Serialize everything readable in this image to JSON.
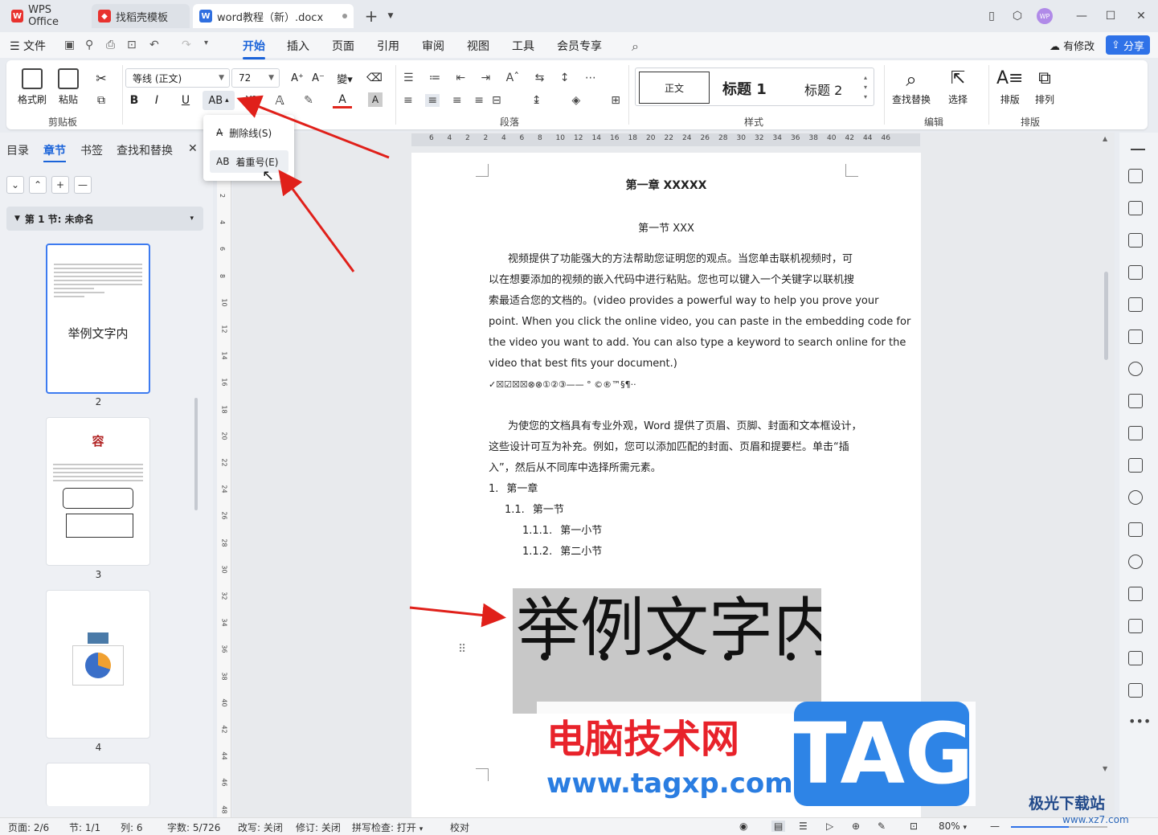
{
  "titlebar": {
    "tabs": [
      {
        "label": "WPS Office"
      },
      {
        "label": "找稻壳模板"
      },
      {
        "label": "word教程（新）.docx"
      }
    ],
    "new_tab": "+",
    "avatar": "WP"
  },
  "menubar": {
    "file": "文件",
    "items": [
      "开始",
      "插入",
      "页面",
      "引用",
      "审阅",
      "视图",
      "工具",
      "会员专享"
    ],
    "modified": "有修改",
    "share": "分享"
  },
  "ribbon": {
    "clipboard": {
      "format_painter": "格式刷",
      "paste": "粘贴",
      "group": "剪贴板"
    },
    "font": {
      "name": "等线 (正文)",
      "size": "72",
      "bold": "B",
      "italic": "I",
      "underline": "U",
      "emphasis_btn": "AB",
      "super": "X²",
      "font_color": "A",
      "highlight": "A"
    },
    "paragraph": {
      "group": "段落"
    },
    "styles": {
      "normal": "正文",
      "h1": "标题 1",
      "h2": "标题 2",
      "group": "样式"
    },
    "edit": {
      "find": "查找替换",
      "select": "选择",
      "group": "编辑"
    },
    "layout": {
      "arrange": "排版",
      "order": "排列",
      "group": "排版"
    }
  },
  "dropdown": {
    "items": [
      {
        "label": "删除线(S)"
      },
      {
        "label": "着重号(E)"
      }
    ]
  },
  "leftpanel": {
    "tabs": [
      "目录",
      "章节",
      "书签",
      "查找和替换"
    ],
    "section": "第 1 节: 未命名",
    "thumb2_text": "举例文字内",
    "thumb3_text": "容",
    "pages": [
      "2",
      "3",
      "4"
    ]
  },
  "ruler": {
    "h_ticks": [
      "6",
      "4",
      "2",
      "2",
      "4",
      "6",
      "8",
      "10",
      "12",
      "14",
      "16",
      "18",
      "20",
      "22",
      "24",
      "26",
      "28",
      "30",
      "32",
      "34",
      "36",
      "38",
      "40",
      "42",
      "44",
      "46"
    ],
    "v_ticks": [
      "2",
      "4",
      "6",
      "8",
      "10",
      "12",
      "14",
      "16",
      "18",
      "20",
      "22",
      "24",
      "26",
      "28",
      "30",
      "32",
      "34",
      "36",
      "38",
      "40",
      "42",
      "44",
      "46",
      "48"
    ]
  },
  "document": {
    "chapter": "第一章  XXXXX",
    "section": "第一节 XXX",
    "p1_lines": [
      "视频提供了功能强大的方法帮助您证明您的观点。当您单击联机视频时，可",
      "以在想要添加的视频的嵌入代码中进行粘贴。您也可以键入一个关键字以联机搜",
      "索最适合您的文档的。(video provides a powerful way to help you prove your",
      "point. When you click the online video, you can paste in the embedding code for",
      "the video you want to add. You can also type a keyword to search online for the",
      "video that best fits your document.)"
    ],
    "symbols": "✓☒☑☒☒⊗⊗①②③——    °  ©®™§¶··",
    "p2_lines": [
      "为使您的文档具有专业外观，Word  提供了页眉、页脚、封面和文本框设计，",
      "这些设计可互为补充。例如，您可以添加匹配的封面、页眉和提要栏。单击“插",
      "入”，然后从不同库中选择所需元素。"
    ],
    "list": [
      {
        "num": "1.",
        "text": "第一章"
      },
      {
        "num": "1.1.",
        "text": "第一节"
      },
      {
        "num": "1.1.1.",
        "text": "第一小节"
      },
      {
        "num": "1.1.2.",
        "text": "第二小节"
      }
    ],
    "big_text": "举例文字内"
  },
  "watermark": {
    "title": "电脑技术网",
    "url": "www.tagxp.com",
    "tag": "TAG",
    "site2": "极光下载站",
    "site2_url": "www.xz7.com"
  },
  "statusbar": {
    "page": "页面: 2/6",
    "section": "节: 1/1",
    "col": "列: 6",
    "words": "字数: 5/726",
    "overwrite": "改写: 关闭",
    "revision": "修订: 关闭",
    "spell": "拼写检查: 打开",
    "proof": "校对",
    "zoom": "80%"
  }
}
